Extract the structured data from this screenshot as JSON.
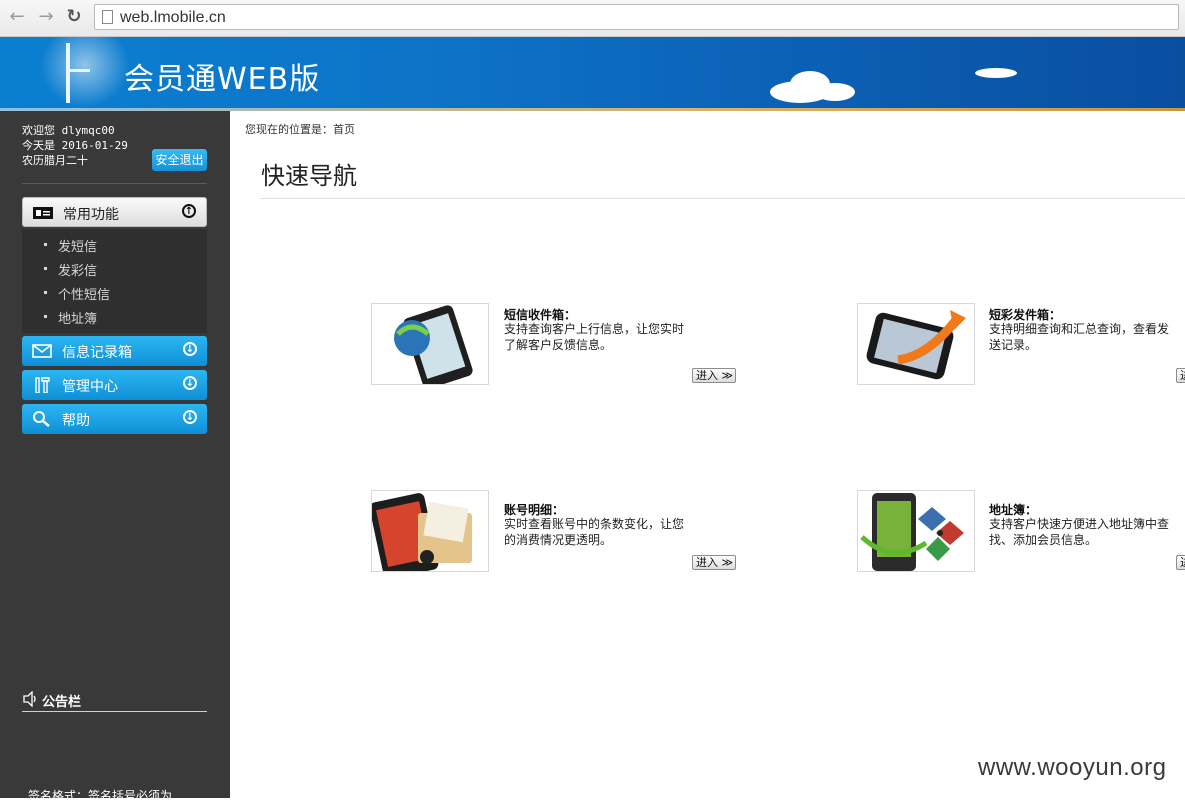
{
  "browser": {
    "url": "web.lmobile.cn"
  },
  "banner": {
    "title": "会员通WEB版"
  },
  "user": {
    "welcome": "欢迎您 dlymqc00",
    "today": "今天是 2016-01-29",
    "lunar": "农历腊月二十",
    "logout_label": "安全退出"
  },
  "sidebar": {
    "common": {
      "label": "常用功能",
      "items": [
        "发短信",
        "发彩信",
        "个性短信",
        "地址簿"
      ]
    },
    "records": {
      "label": "信息记录箱"
    },
    "admin": {
      "label": "管理中心"
    },
    "help": {
      "label": "帮助"
    },
    "notice": {
      "label": "公告栏",
      "text": "签名格式：签名括号必须为"
    }
  },
  "main": {
    "breadcrumb": "您现在的位置是：首页",
    "title": "快速导航",
    "enter_label": "进入",
    "cards": [
      {
        "title": "短信收件箱：",
        "desc": "支持查询客户上行信息，让您实时了解客户反馈信息。"
      },
      {
        "title": "短彩发件箱：",
        "desc": "支持明细查询和汇总查询，查看发送记录。"
      },
      {
        "title": "账号明细：",
        "desc": "实时查看账号中的条数变化，让您的消费情况更透明。"
      },
      {
        "title": "地址簿：",
        "desc": "支持客户快速方便进入地址簿中查找、添加会员信息。"
      }
    ]
  },
  "watermark": "www.wooyun.org"
}
